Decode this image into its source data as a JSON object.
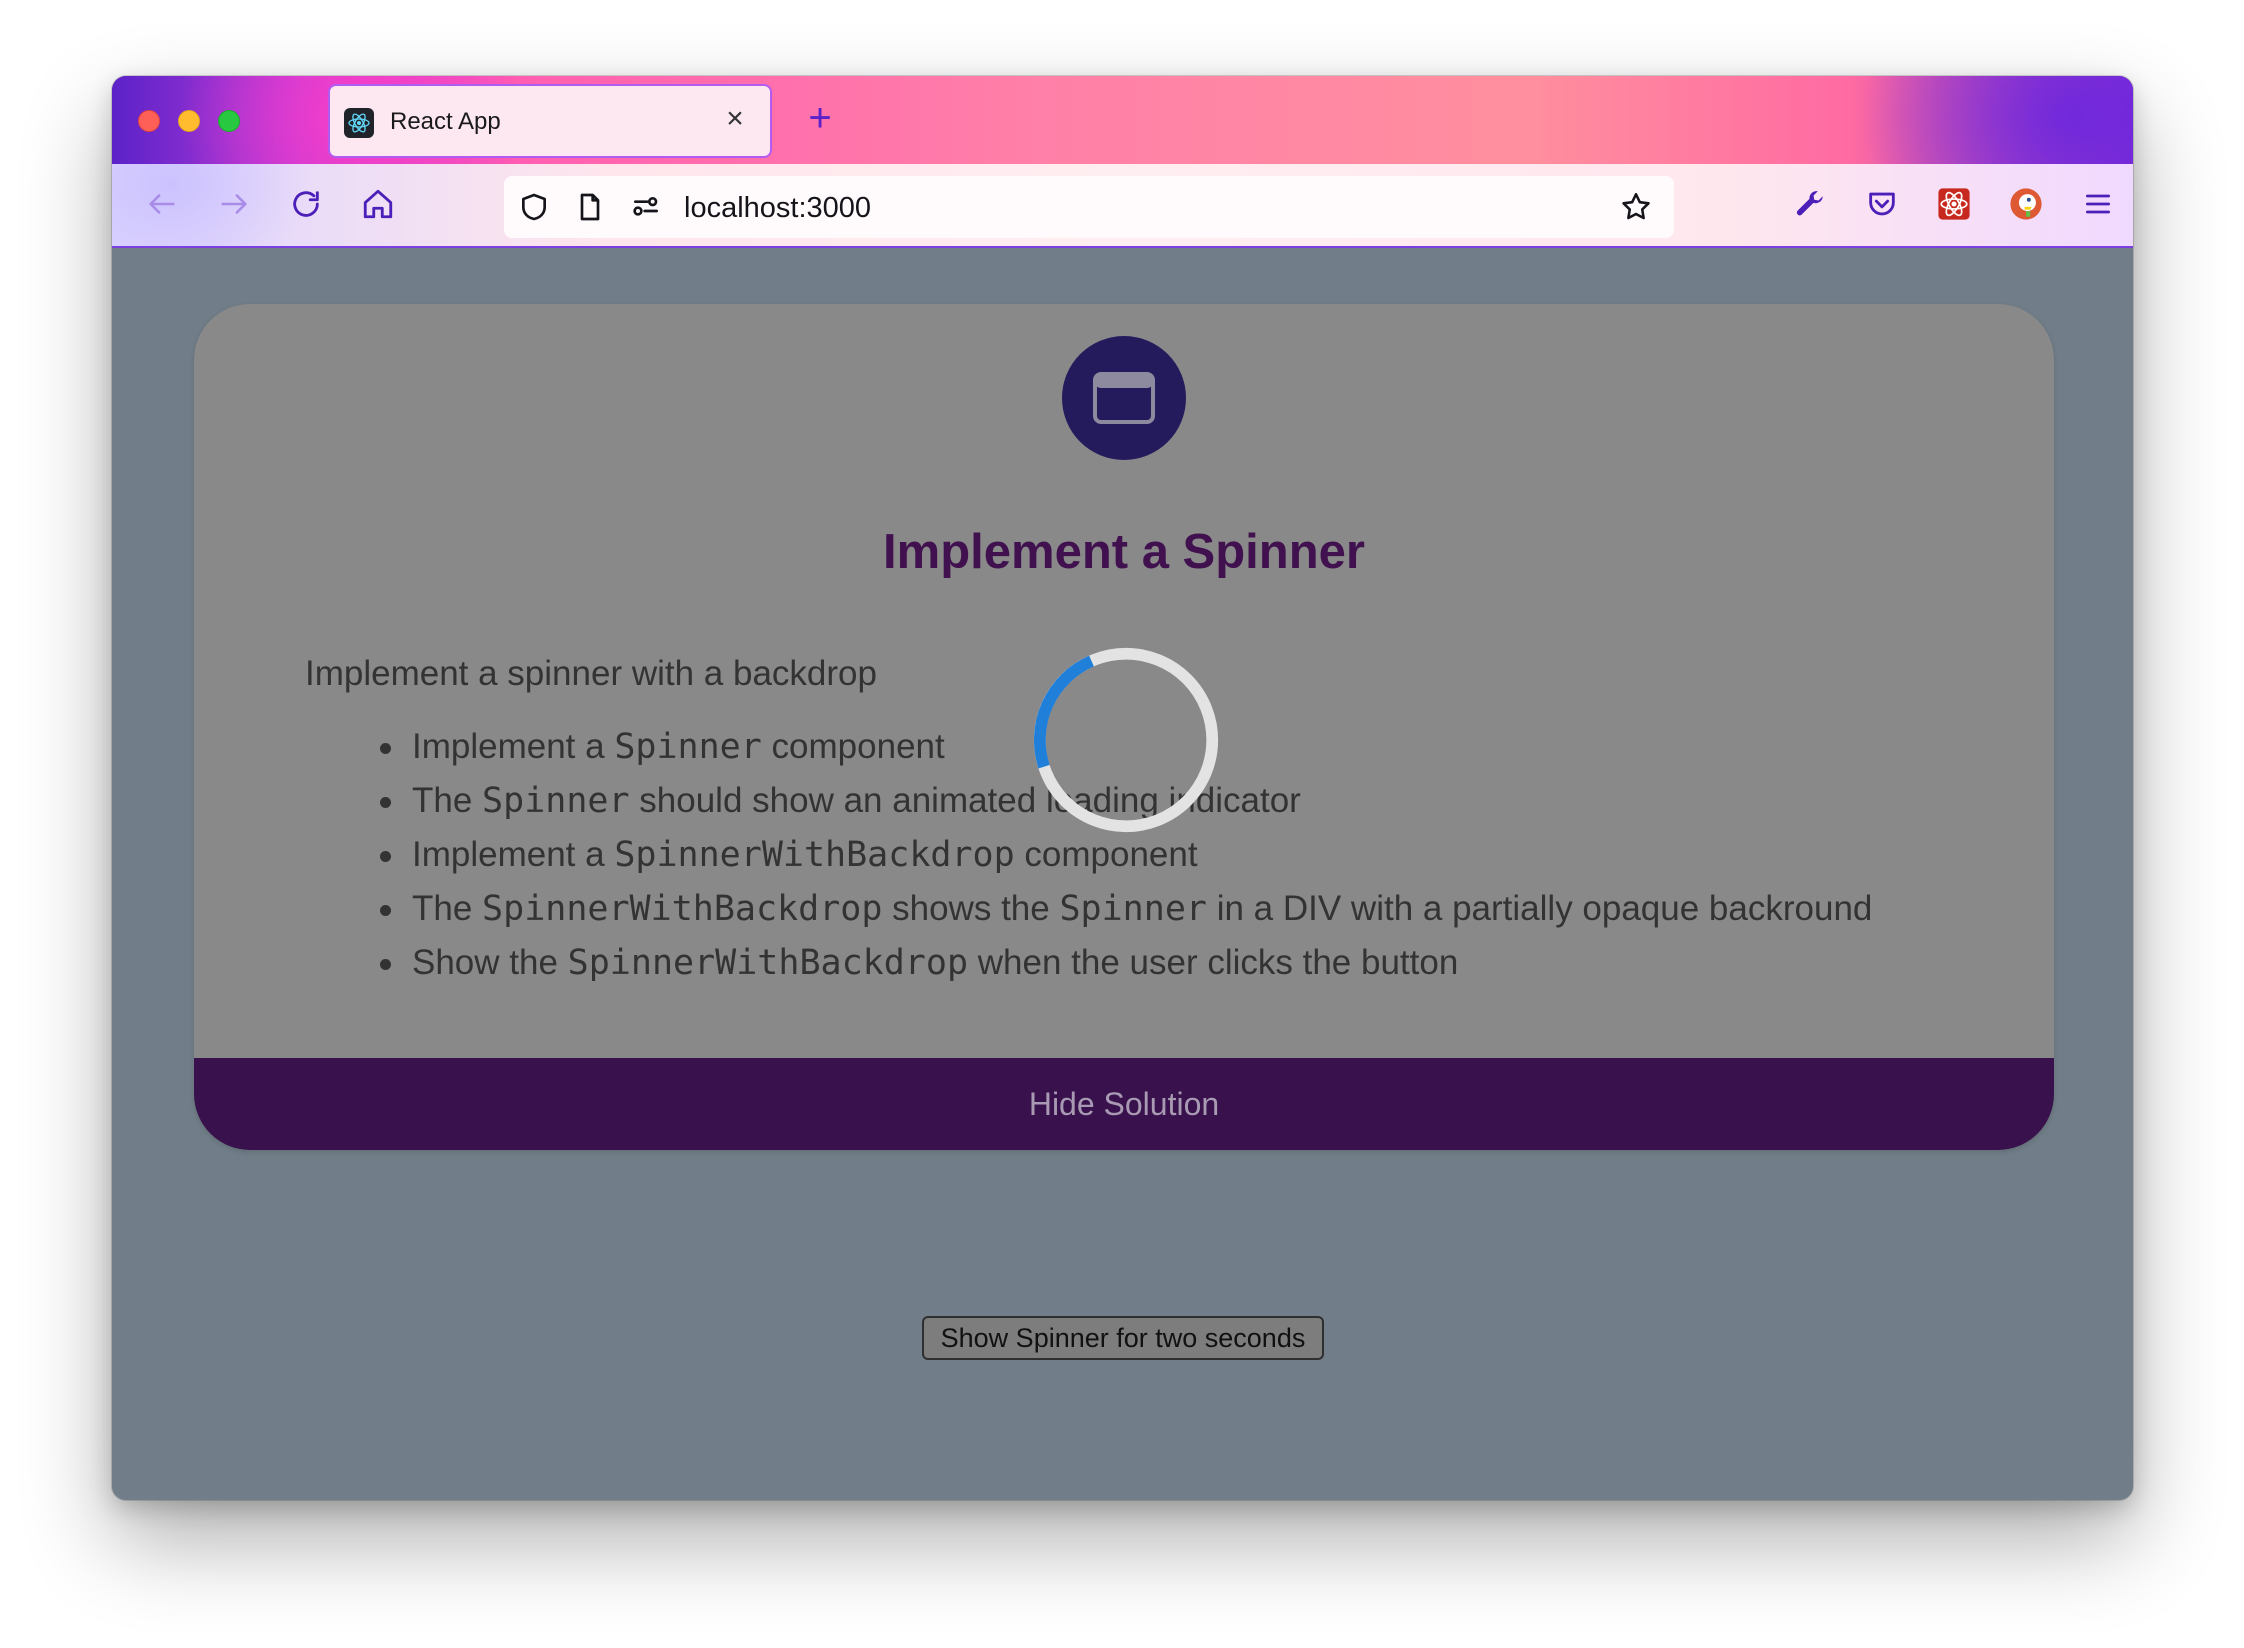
{
  "browser": {
    "tab_title": "React App",
    "tab_close": "×",
    "new_tab": "+",
    "url": "localhost:3000"
  },
  "card": {
    "title": "Implement a Spinner",
    "intro": "Implement a spinner with a backdrop",
    "bullets": [
      [
        {
          "t": "Implement a "
        },
        {
          "c": "Spinner"
        },
        {
          "t": " component"
        }
      ],
      [
        {
          "t": "The "
        },
        {
          "c": "Spinner"
        },
        {
          "t": " should show an animated loading indicator"
        }
      ],
      [
        {
          "t": "Implement a "
        },
        {
          "c": "SpinnerWithBackdrop"
        },
        {
          "t": " component"
        }
      ],
      [
        {
          "t": "The "
        },
        {
          "c": "SpinnerWithBackdrop"
        },
        {
          "t": " shows the "
        },
        {
          "c": "Spinner"
        },
        {
          "t": " in a DIV with a partially opaque backround"
        }
      ],
      [
        {
          "t": "Show the "
        },
        {
          "c": "SpinnerWithBackdrop"
        },
        {
          "t": " when the user clicks the button"
        }
      ]
    ],
    "footer_label": "Hide Solution"
  },
  "actions": {
    "show_spinner_label": "Show Spinner for two seconds"
  },
  "colors": {
    "page_bg": "#717e89",
    "card_bg": "#898989",
    "title": "#40104f",
    "footer_bg": "#38114d",
    "spinner_track": "#e3e3e3",
    "spinner_arc": "#1f7fd9"
  }
}
